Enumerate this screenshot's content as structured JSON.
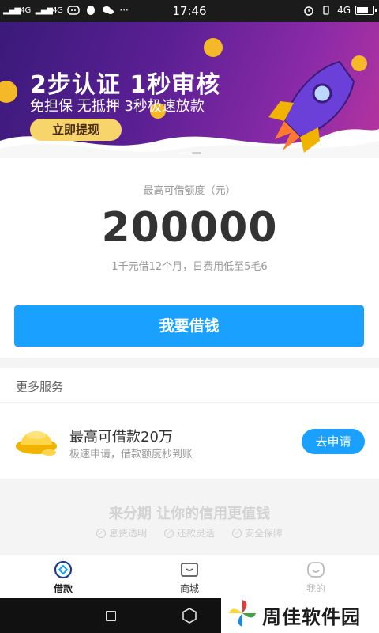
{
  "status_bar": {
    "left_signal_1": "4G",
    "left_signal_2": "4G",
    "time": "17:46",
    "network": "4G",
    "battery_level": 0.75
  },
  "banner": {
    "title": "2步认证  1秒审核",
    "subtitle": "免担保 无抵押 3秒极速放款",
    "cta_label": "立即提现"
  },
  "quota": {
    "label": "最高可借额度（元）",
    "amount": "200000",
    "hint": "1千元借12个月，日费用低至5毛6",
    "borrow_button": "我要借钱"
  },
  "more_services": {
    "header": "更多服务",
    "items": [
      {
        "name": "最高可借款20万",
        "desc": "极速申请，借款额度秒到账",
        "action": "去申请"
      }
    ]
  },
  "slogan": {
    "main": "来分期  让你的信用更值钱",
    "tags": [
      "息费透明",
      "还款灵活",
      "安全保障"
    ]
  },
  "tabbar": {
    "tabs": [
      {
        "label": "借款",
        "icon": "loan-icon",
        "active": true
      },
      {
        "label": "商城",
        "icon": "shop-icon",
        "active": false
      },
      {
        "label": "我的",
        "icon": "profile-icon",
        "active": false
      }
    ]
  },
  "watermark": {
    "text": "周佳软件园"
  },
  "colors": {
    "primary": "#1aa1ff",
    "banner_gold": "#f7d56a"
  }
}
